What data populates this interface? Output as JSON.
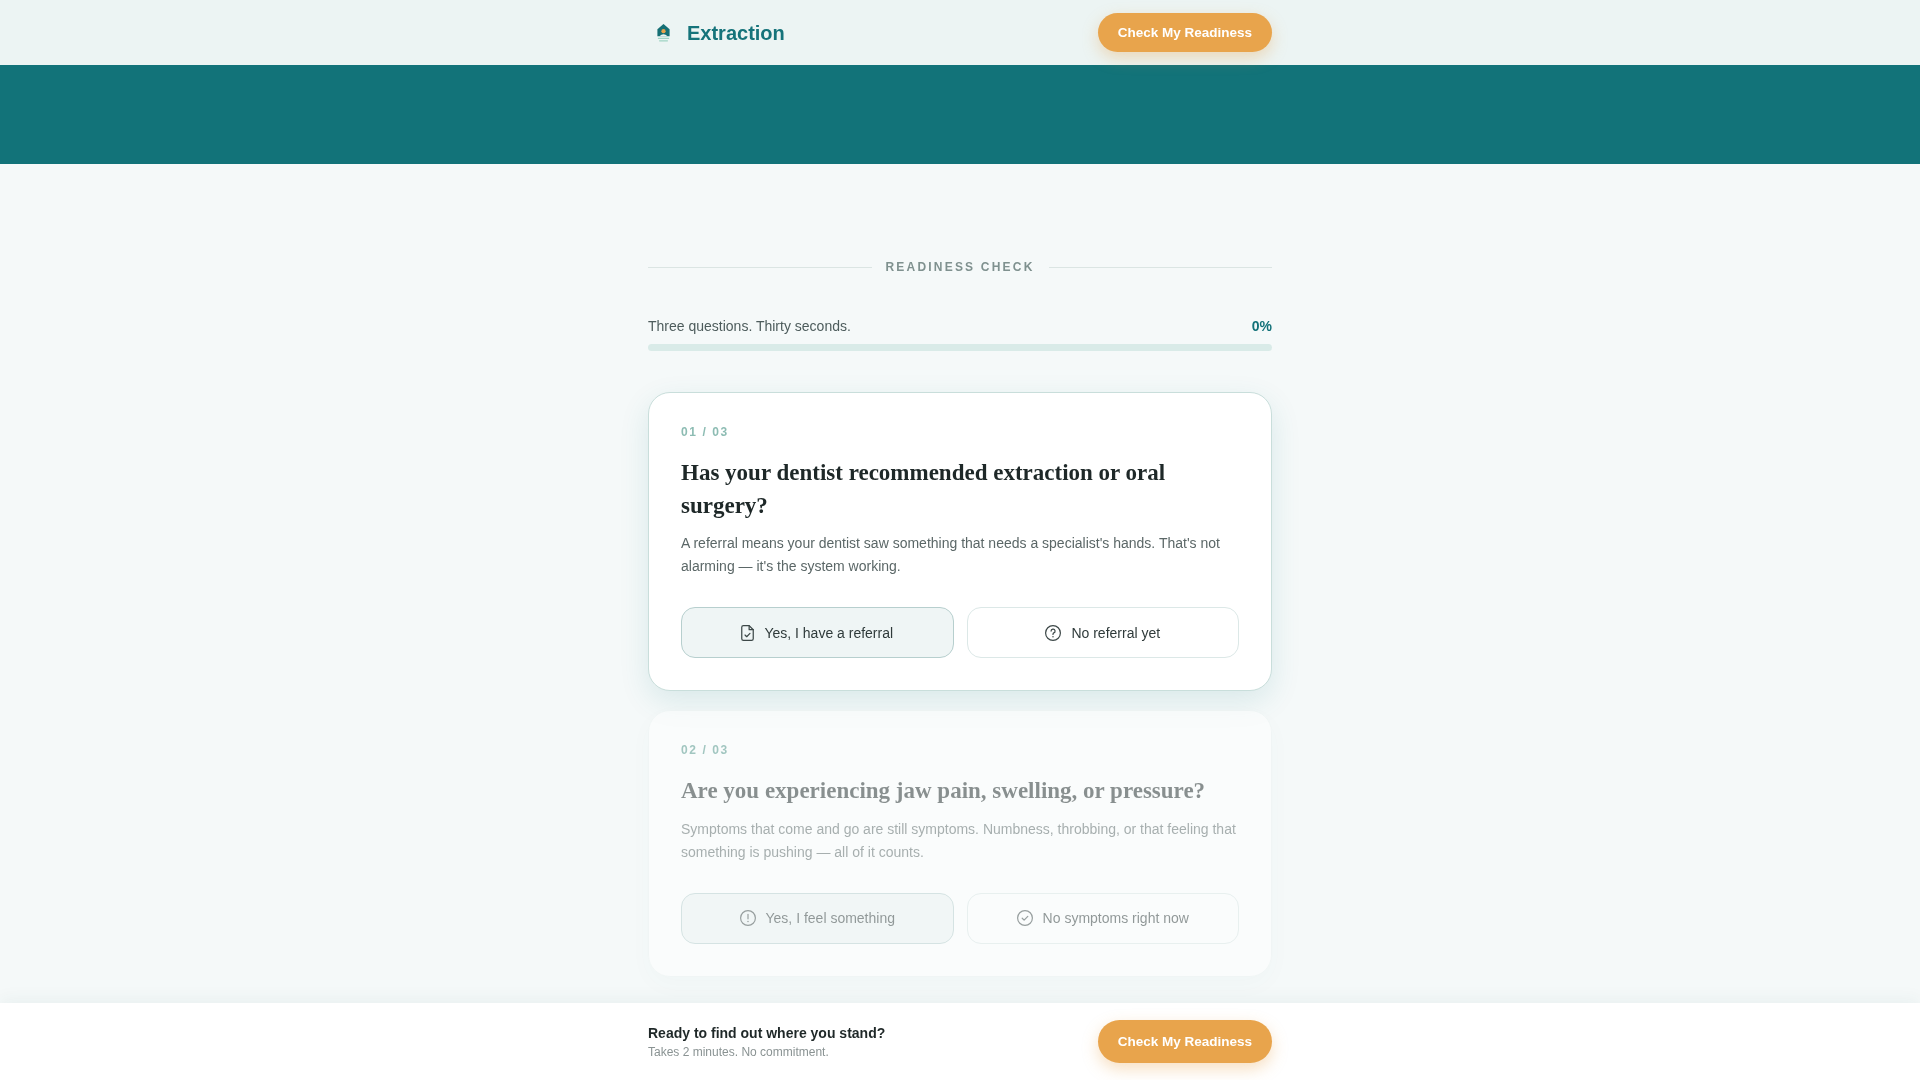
{
  "header": {
    "brand": "Extraction",
    "cta": "Check My Readiness"
  },
  "section": {
    "eyebrow": "READINESS CHECK",
    "intro": "Three questions. Thirty seconds.",
    "percent": "0%",
    "progress": {
      "level": 0
    }
  },
  "questions": [
    {
      "number": "01 / 03",
      "active": true,
      "title": "Has your dentist recommended extraction or oral surgery?",
      "description": "A referral means your dentist saw something that needs a specialist's hands. That's not alarming — it's the system working.",
      "options": [
        {
          "label": "Yes, I have a referral",
          "kind": "primary"
        },
        {
          "label": "No referral yet",
          "kind": "secondary"
        }
      ]
    },
    {
      "number": "02 / 03",
      "active": false,
      "title": "Are you experiencing jaw pain, swelling, or pressure?",
      "description": "Symptoms that come and go are still symptoms. Numbness, throbbing, or that feeling that something is pushing — all of it counts.",
      "options": [
        {
          "label": "Yes, I feel something",
          "kind": "primary"
        },
        {
          "label": "No symptoms right now",
          "kind": "secondary"
        }
      ]
    }
  ],
  "bottom_bar": {
    "title": "Ready to find out where you stand?",
    "subtitle": "Takes 2 minutes. No commitment.",
    "cta": "Check My Readiness"
  }
}
